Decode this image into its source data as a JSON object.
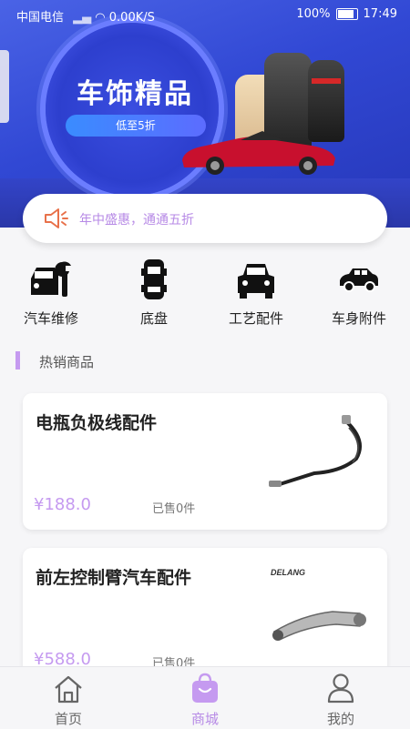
{
  "status_bar": {
    "carrier": "中国电信",
    "speed": "0.00K/S",
    "battery": "100%",
    "time": "17:49"
  },
  "banner": {
    "title": "车饰精品",
    "subtitle": "低至5折"
  },
  "notice": {
    "text": "年中盛惠，通通五折"
  },
  "categories": [
    {
      "label": "汽车维修",
      "icon": "car-repair-icon"
    },
    {
      "label": "底盘",
      "icon": "chassis-icon"
    },
    {
      "label": "工艺配件",
      "icon": "car-front-icon"
    },
    {
      "label": "车身附件",
      "icon": "car-side-icon"
    }
  ],
  "section": {
    "title": "热销商品"
  },
  "products": [
    {
      "name": "电瓶负极线配件",
      "price": "¥188.0",
      "sold": "已售0件"
    },
    {
      "name": "前左控制臂汽车配件",
      "price": "¥588.0",
      "sold": "已售0件",
      "brand": "DELANG"
    }
  ],
  "tabs": [
    {
      "label": "首页",
      "icon": "home-icon",
      "active": false
    },
    {
      "label": "商城",
      "icon": "shopping-bag-icon",
      "active": true
    },
    {
      "label": "我的",
      "icon": "user-icon",
      "active": false
    }
  ],
  "colors": {
    "accent": "#b78ae6",
    "banner": "#3148d4"
  }
}
